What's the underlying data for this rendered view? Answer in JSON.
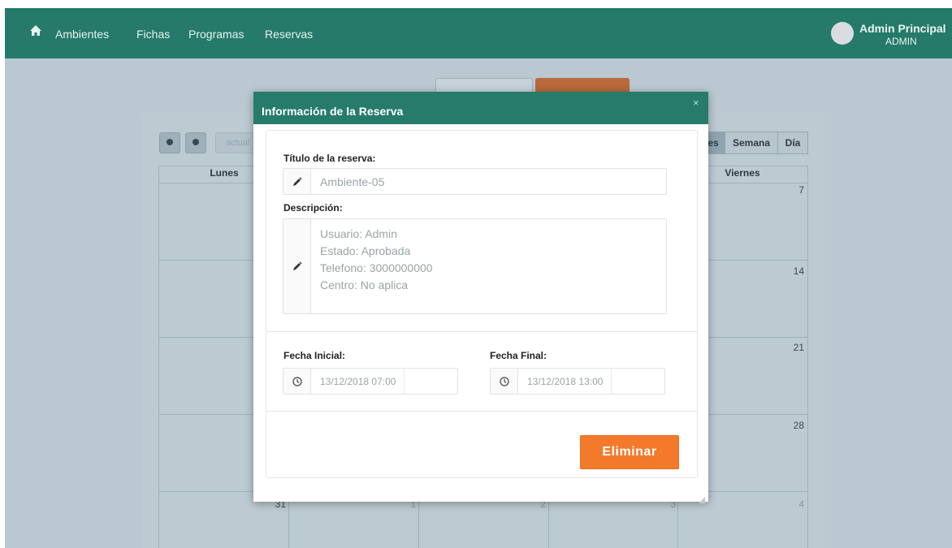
{
  "nav": {
    "links": [
      "Ambientes",
      "Fichas",
      "Programas",
      "Reservas"
    ],
    "user_name": "Admin Principal",
    "user_role": "ADMIN"
  },
  "calendar": {
    "today_label": "actual",
    "views": [
      "es",
      "Semana",
      "Día"
    ],
    "day_headers": [
      "Lunes",
      "Viernes"
    ],
    "day_numbers_friday": [
      "7",
      "14",
      "21",
      "28"
    ],
    "last_row_numbers": [
      "31",
      "1",
      "2",
      "3",
      "4"
    ]
  },
  "modal": {
    "title": "Información de la Reserva",
    "close_label": "×",
    "title_label": "Título de la reserva:",
    "title_value": "Ambiente-05",
    "description_label": "Descripción:",
    "description_lines": [
      "Usuario: Admin",
      "Estado: Aprobada",
      "Telefono: 3000000000",
      "Centro: No aplica"
    ],
    "start_label": "Fecha Inicial:",
    "start_value": "13/12/2018 07:00",
    "end_label": "Fecha Final:",
    "end_value": "13/12/2018 13:00",
    "delete_label": "Eliminar"
  },
  "colors": {
    "navbar": "#257a6a",
    "modal_header": "#267b6b",
    "delete_button": "#f47a2b"
  }
}
